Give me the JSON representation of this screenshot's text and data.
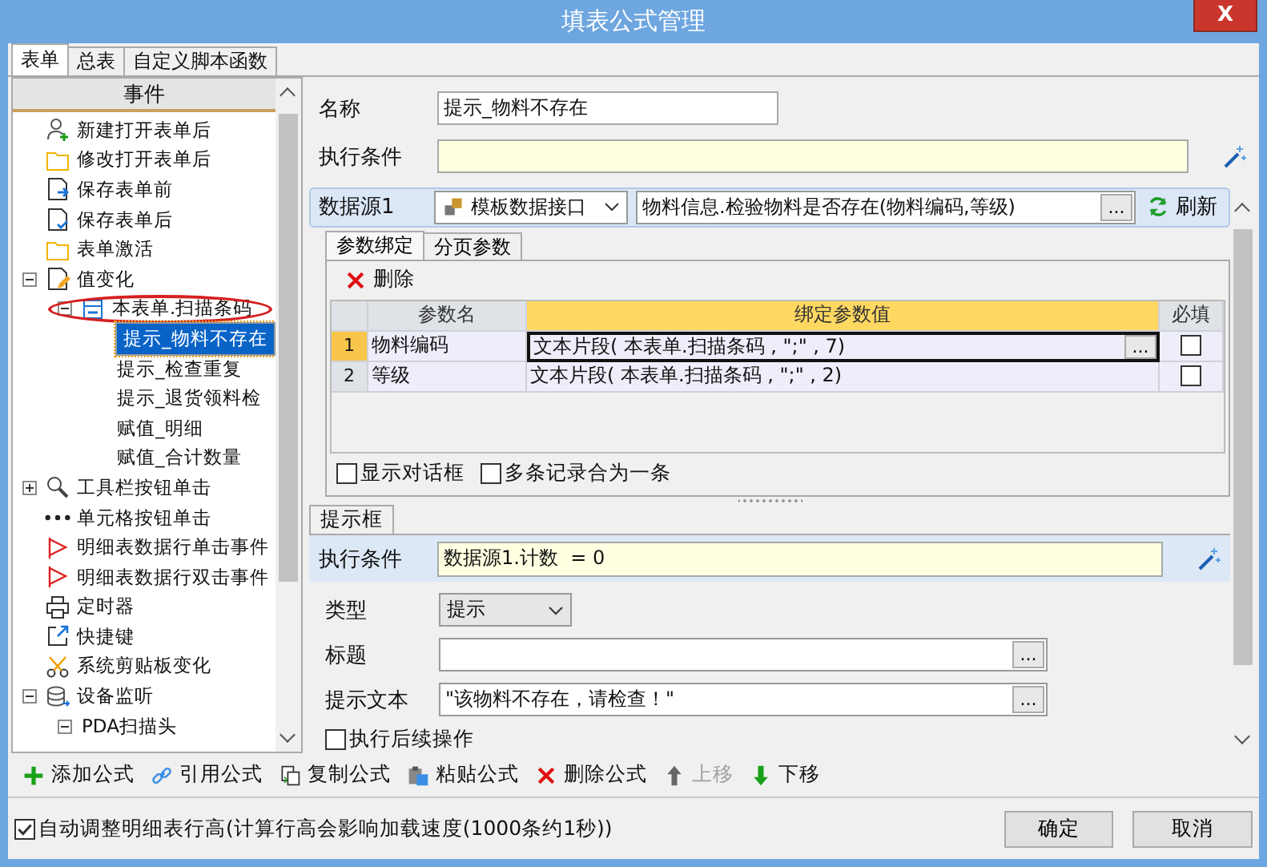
{
  "window": {
    "title": "填表公式管理",
    "close_label": "X"
  },
  "tabs": [
    {
      "label": "表单",
      "selected": true
    },
    {
      "label": "总表",
      "selected": false
    },
    {
      "label": "自定义脚本函数",
      "selected": false
    }
  ],
  "tree": {
    "header": "事件",
    "items": [
      {
        "label": "新建打开表单后",
        "kind": "user-plus",
        "selected": false,
        "circled": false
      },
      {
        "label": "修改打开表单后",
        "kind": "folder",
        "selected": false,
        "circled": false
      },
      {
        "label": "保存表单前",
        "kind": "save-arrow",
        "selected": false,
        "circled": false
      },
      {
        "label": "保存表单后",
        "kind": "save-check",
        "selected": false,
        "circled": false
      },
      {
        "label": "表单激活",
        "kind": "folder",
        "selected": false,
        "circled": false
      },
      {
        "label": "值变化",
        "kind": "edit-doc",
        "selected": false,
        "circled": false,
        "expanded": true,
        "children": [
          {
            "label": "本表单.扫描条码",
            "kind": "form",
            "selected": false,
            "circled": true,
            "expanded": true,
            "children": [
              {
                "label": "提示_物料不存在",
                "selected": true,
                "circled": false
              },
              {
                "label": "提示_检查重复",
                "selected": false,
                "circled": false
              },
              {
                "label": "提示_退货领料检",
                "selected": false,
                "circled": false
              },
              {
                "label": "赋值_明细",
                "selected": false,
                "circled": false
              },
              {
                "label": "赋值_合计数量",
                "selected": false,
                "circled": false
              }
            ]
          }
        ]
      },
      {
        "label": "工具栏按钮单击",
        "kind": "magnifier",
        "selected": false,
        "circled": false,
        "expanded": false
      },
      {
        "label": "单元格按钮单击",
        "kind": "dots",
        "selected": false,
        "circled": false
      },
      {
        "label": "明细表数据行单击事件",
        "kind": "flag",
        "selected": false,
        "circled": false
      },
      {
        "label": "明细表数据行双击事件",
        "kind": "flag",
        "selected": false,
        "circled": false
      },
      {
        "label": "定时器",
        "kind": "printer",
        "selected": false,
        "circled": false
      },
      {
        "label": "快捷键",
        "kind": "external",
        "selected": false,
        "circled": false
      },
      {
        "label": "系统剪贴板变化",
        "kind": "scissors",
        "selected": false,
        "circled": false
      },
      {
        "label": "设备监听",
        "kind": "database",
        "selected": false,
        "circled": false,
        "expanded": true,
        "children": [
          {
            "label": "PDA扫描头",
            "selected": false,
            "circled": false,
            "expanded": true
          }
        ]
      }
    ]
  },
  "form": {
    "name_label": "名称",
    "name_value": "提示_物料不存在",
    "condition_label": "执行条件"
  },
  "datasource": {
    "label": "数据源1",
    "type_value": "模板数据接口",
    "method_value": "物料信息.检验物料是否存在(物料编码,等级)",
    "browse_button": "...",
    "refresh_label": "刷新"
  },
  "param_tabs": [
    {
      "label": "参数绑定",
      "selected": true
    },
    {
      "label": "分页参数",
      "selected": false
    }
  ],
  "param_toolbar": {
    "delete_label": "删除"
  },
  "param_grid": {
    "columns": [
      {
        "label": "参数名",
        "selected": false
      },
      {
        "label": "绑定参数值",
        "selected": true
      },
      {
        "label": "必填",
        "selected": false
      }
    ],
    "rows": [
      {
        "number": "1",
        "name": "物料编码",
        "value": "文本片段( 本表单.扫描条码 , \";\" , 7)",
        "required": false,
        "selected": true
      },
      {
        "number": "2",
        "name": "等级",
        "value": "文本片段( 本表单.扫描条码 , \";\" , 2)",
        "required": false,
        "selected": false
      }
    ],
    "cell_button": "..."
  },
  "param_options": [
    {
      "label": "显示对话框",
      "checked": false
    },
    {
      "label": "多条记录合为一条",
      "checked": false
    }
  ],
  "message_box": {
    "tab_label": "提示框",
    "condition_label": "执行条件",
    "condition_value": "数据源1.计数  = 0",
    "type_label": "类型",
    "type_value": "提示",
    "title_label": "标题",
    "title_button": "...",
    "text_label": "提示文本",
    "text_value": "\"该物料不存在，请检查！\"",
    "text_button": "...",
    "continue_option": {
      "label": "执行后续操作",
      "checked": false
    }
  },
  "toolbar": [
    {
      "label": "添加公式",
      "kind": "plus",
      "disabled": false
    },
    {
      "label": "引用公式",
      "kind": "link",
      "disabled": false
    },
    {
      "label": "复制公式",
      "kind": "copy",
      "disabled": false
    },
    {
      "label": "粘贴公式",
      "kind": "paste",
      "disabled": false
    },
    {
      "label": "删除公式",
      "kind": "cross",
      "disabled": false
    },
    {
      "label": "上移",
      "kind": "up",
      "disabled": true
    },
    {
      "label": "下移",
      "kind": "down",
      "disabled": false
    }
  ],
  "footer": {
    "auto_height": {
      "label": "自动调整明细表行高(计算行高会影响加载速度(1000条约1秒))",
      "checked": true
    },
    "buttons": [
      "确定",
      "取消"
    ]
  }
}
